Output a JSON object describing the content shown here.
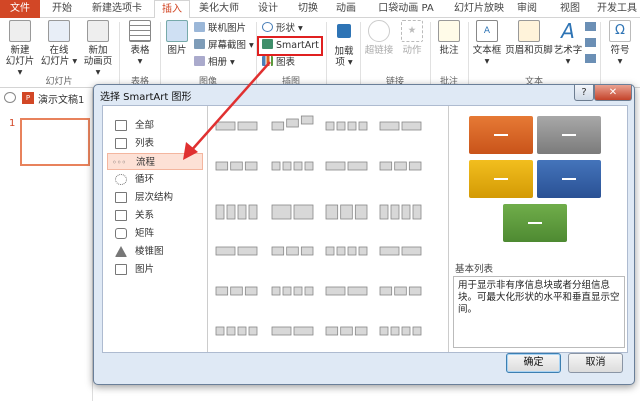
{
  "tabs": [
    "文件",
    "开始",
    "新建选项卡",
    "插入",
    "美化大师",
    "设计",
    "切换",
    "动画",
    "口袋动画 PA",
    "幻灯片放映",
    "审阅",
    "视图",
    "开发工具"
  ],
  "ribbon": {
    "new_slide": [
      "新建",
      "幻灯片 ▾"
    ],
    "online_slide": [
      "在线",
      "幻灯片 ▾"
    ],
    "new_anim_page": [
      "新加",
      "动画页 ▾"
    ],
    "table": "表格",
    "picture": "图片",
    "online_picture": "联机图片",
    "screenshot": "屏幕截图 ▾",
    "album": "相册 ▾",
    "shapes": "形状 ▾",
    "smartart": "SmartArt",
    "chart": "图表",
    "addins": [
      "加载",
      "项 ▾"
    ],
    "hyperlink": "超链接",
    "action": "动作",
    "comment": "批注",
    "textbox": "文本框",
    "header_footer": "页眉和页脚",
    "wordart": "艺术字",
    "symbol": "符号",
    "groups": {
      "slides": "幻灯片",
      "tables": "表格",
      "images": "图像",
      "illustrations": "插图",
      "links": "链接",
      "comments": "批注",
      "text": "文本"
    }
  },
  "document": {
    "name": "演示文稿1",
    "slide_number": "1"
  },
  "dialog": {
    "title": "选择 SmartArt 图形",
    "help": "?",
    "close": "✕",
    "categories": [
      "全部",
      "列表",
      "流程",
      "循环",
      "层次结构",
      "关系",
      "矩阵",
      "棱锥图",
      "图片"
    ],
    "selected_category": "流程",
    "preview_title": "基本列表",
    "preview_desc": "用于显示非有序信息块或者分组信息块。可最大化形状的水平和垂直显示空间。",
    "preview_colors": [
      "#d9611f",
      "#8d8d8d",
      "#e2a70a",
      "#2f5ea6",
      "#5c9a3d"
    ],
    "ok": "确定",
    "cancel": "取消"
  }
}
